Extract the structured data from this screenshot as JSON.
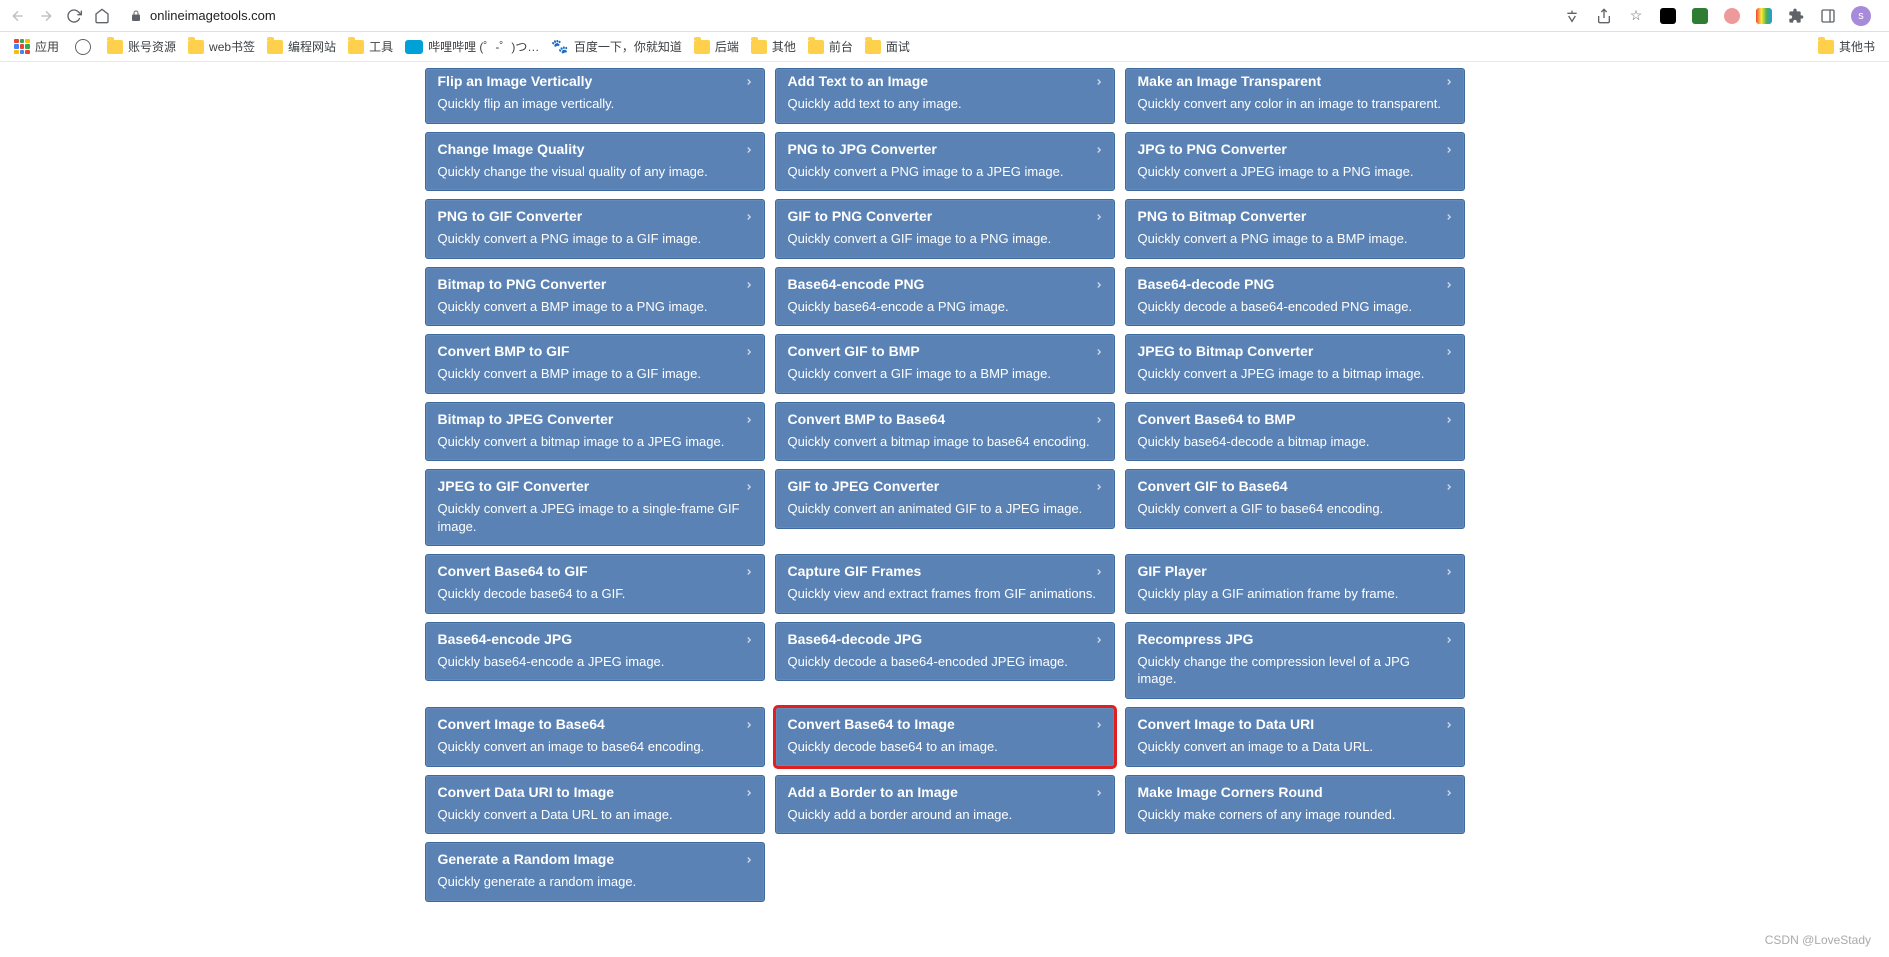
{
  "browser": {
    "url": "onlineimagetools.com",
    "avatar_letter": "s"
  },
  "bookmarks": {
    "apps": "应用",
    "items": [
      {
        "label": "账号资源",
        "icon": "folder"
      },
      {
        "label": "web书签",
        "icon": "folder"
      },
      {
        "label": "编程网站",
        "icon": "folder"
      },
      {
        "label": "工具",
        "icon": "folder"
      },
      {
        "label": "哔哩哔哩 (゜-゜)つ…",
        "icon": "bili"
      },
      {
        "label": "百度一下，你就知道",
        "icon": "paw"
      },
      {
        "label": "后端",
        "icon": "folder"
      },
      {
        "label": "其他",
        "icon": "folder"
      },
      {
        "label": "前台",
        "icon": "folder"
      },
      {
        "label": "面试",
        "icon": "folder"
      }
    ],
    "overflow": "其他书"
  },
  "cards": [
    [
      {
        "title": "Flip an Image Vertically",
        "desc": "Quickly flip an image vertically.",
        "partial": true
      },
      {
        "title": "Add Text to an Image",
        "desc": "Quickly add text to any image.",
        "partial": true
      },
      {
        "title": "Make an Image Transparent",
        "desc": "Quickly convert any color in an image to transparent.",
        "partial": true
      }
    ],
    [
      {
        "title": "Change Image Quality",
        "desc": "Quickly change the visual quality of any image."
      },
      {
        "title": "PNG to JPG Converter",
        "desc": "Quickly convert a PNG image to a JPEG image."
      },
      {
        "title": "JPG to PNG Converter",
        "desc": "Quickly convert a JPEG image to a PNG image."
      }
    ],
    [
      {
        "title": "PNG to GIF Converter",
        "desc": "Quickly convert a PNG image to a GIF image."
      },
      {
        "title": "GIF to PNG Converter",
        "desc": "Quickly convert a GIF image to a PNG image."
      },
      {
        "title": "PNG to Bitmap Converter",
        "desc": "Quickly convert a PNG image to a BMP image."
      }
    ],
    [
      {
        "title": "Bitmap to PNG Converter",
        "desc": "Quickly convert a BMP image to a PNG image."
      },
      {
        "title": "Base64-encode PNG",
        "desc": "Quickly base64-encode a PNG image."
      },
      {
        "title": "Base64-decode PNG",
        "desc": "Quickly decode a base64-encoded PNG image."
      }
    ],
    [
      {
        "title": "Convert BMP to GIF",
        "desc": "Quickly convert a BMP image to a GIF image."
      },
      {
        "title": "Convert GIF to BMP",
        "desc": "Quickly convert a GIF image to a BMP image."
      },
      {
        "title": "JPEG to Bitmap Converter",
        "desc": "Quickly convert a JPEG image to a bitmap image."
      }
    ],
    [
      {
        "title": "Bitmap to JPEG Converter",
        "desc": "Quickly convert a bitmap image to a JPEG image."
      },
      {
        "title": "Convert BMP to Base64",
        "desc": "Quickly convert a bitmap image to base64 encoding."
      },
      {
        "title": "Convert Base64 to BMP",
        "desc": "Quickly base64-decode a bitmap image."
      }
    ],
    [
      {
        "title": "JPEG to GIF Converter",
        "desc": "Quickly convert a JPEG image to a single-frame GIF image."
      },
      {
        "title": "GIF to JPEG Converter",
        "desc": "Quickly convert an animated GIF to a JPEG image."
      },
      {
        "title": "Convert GIF to Base64",
        "desc": "Quickly convert a GIF to base64 encoding."
      }
    ],
    [
      {
        "title": "Convert Base64 to GIF",
        "desc": "Quickly decode base64 to a GIF."
      },
      {
        "title": "Capture GIF Frames",
        "desc": "Quickly view and extract frames from GIF animations."
      },
      {
        "title": "GIF Player",
        "desc": "Quickly play a GIF animation frame by frame."
      }
    ],
    [
      {
        "title": "Base64-encode JPG",
        "desc": "Quickly base64-encode a JPEG image."
      },
      {
        "title": "Base64-decode JPG",
        "desc": "Quickly decode a base64-encoded JPEG image."
      },
      {
        "title": "Recompress JPG",
        "desc": "Quickly change the compression level of a JPG image."
      }
    ],
    [
      {
        "title": "Convert Image to Base64",
        "desc": "Quickly convert an image to base64 encoding."
      },
      {
        "title": "Convert Base64 to Image",
        "desc": "Quickly decode base64 to an image.",
        "highlight": true
      },
      {
        "title": "Convert Image to Data URI",
        "desc": "Quickly convert an image to a Data URL."
      }
    ],
    [
      {
        "title": "Convert Data URI to Image",
        "desc": "Quickly convert a Data URL to an image."
      },
      {
        "title": "Add a Border to an Image",
        "desc": "Quickly add a border around an image."
      },
      {
        "title": "Make Image Corners Round",
        "desc": "Quickly make corners of any image rounded."
      }
    ],
    [
      {
        "title": "Generate a Random Image",
        "desc": "Quickly generate a random image."
      }
    ]
  ],
  "watermark": "CSDN @LoveStady"
}
